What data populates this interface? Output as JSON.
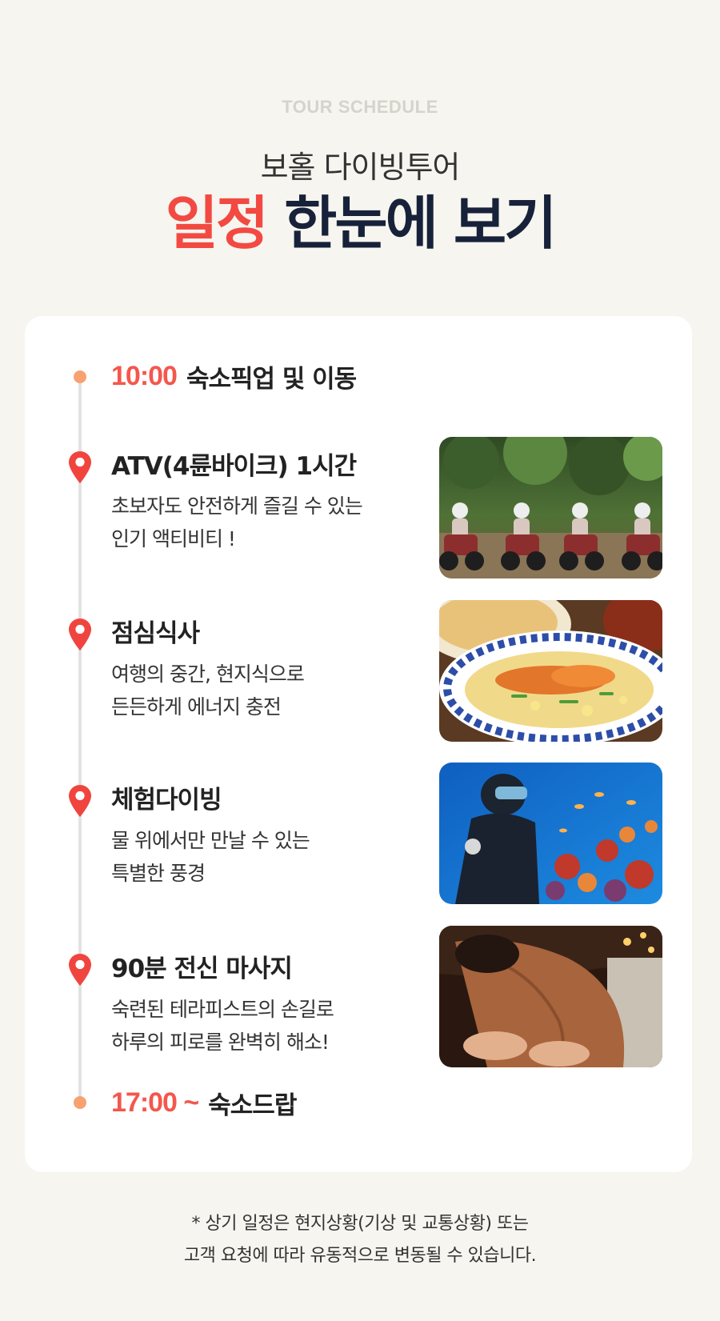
{
  "header": {
    "eyebrow": "TOUR SCHEDULE",
    "subtitle": "보홀 다이빙투어",
    "title_accent": "일정",
    "title_rest": "한눈에 보기"
  },
  "schedule": {
    "start": {
      "time": "10:00",
      "label": "숙소픽업 및 이동"
    },
    "items": [
      {
        "title": "ATV(4륜바이크) 1시간",
        "desc_line1": "초보자도 안전하게 즐길 수 있는",
        "desc_line2": "인기 액티비티 !",
        "image": "atv-riders-photo"
      },
      {
        "title": "점심식사",
        "desc_line1": "여행의 중간, 현지식으로",
        "desc_line2": "든든하게 에너지 충전",
        "image": "seafood-lunch-photo"
      },
      {
        "title": "체험다이빙",
        "desc_line1": "물 위에서만 만날 수 있는",
        "desc_line2": "특별한 풍경",
        "image": "scuba-diver-coral-photo"
      },
      {
        "title": "90분 전신 마사지",
        "desc_line1": "숙련된 테라피스트의 손길로",
        "desc_line2": "하루의 피로를 완벽히 해소!",
        "image": "back-massage-photo"
      }
    ],
    "end": {
      "time": "17:00 ~",
      "label": "숙소드랍"
    }
  },
  "footnote": {
    "line1": "* 상기 일정은 현지상황(기상 및 교통상황) 또는",
    "line2": "고객 요청에 따라 유동적으로 변동될 수 있습니다."
  },
  "colors": {
    "accent": "#f24a42",
    "navy": "#17223a",
    "dot": "#f6a271",
    "pin": "#f0453e",
    "background": "#f6f5ef"
  },
  "icons": [
    "map-pin-icon",
    "timeline-dot-icon"
  ]
}
